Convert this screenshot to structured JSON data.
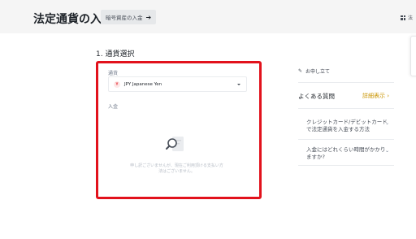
{
  "header": {
    "title": "法定通貨の入金",
    "crypto_button_label": "暗号資産の入金",
    "history_label": "法"
  },
  "form": {
    "step_title": "1. 通貨選択",
    "currency_label": "通貨",
    "selected_currency": "JPY Japanese Yen",
    "currency_icon_symbol": "¥",
    "deposit_label": "入金",
    "empty_message": "申し訳ございませんが、現在ご利用頂ける支払い方法はございません。"
  },
  "sidebar": {
    "apply_label": "お申し立て",
    "faq_title": "よくある質問",
    "faq_more_label": "詳細表示 ›",
    "faq_items": [
      "クレジットカード/デビットカードで法定通貨を入金する方法",
      "入金にはどれくらい時間がかかりますか?"
    ]
  },
  "colors": {
    "accent": "#c99400",
    "highlight_border": "#e2121c",
    "header_bg": "#f5f5f5"
  }
}
